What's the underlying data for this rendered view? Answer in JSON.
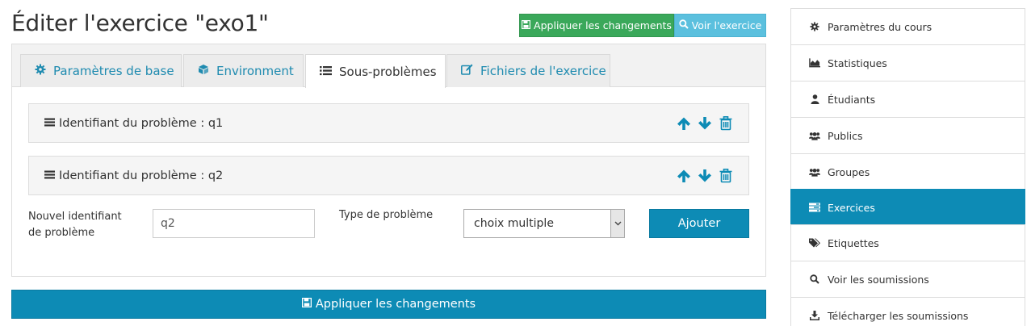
{
  "header": {
    "title": "Éditer l'exercice \"exo1\"",
    "apply_label": "Appliquer les changements",
    "view_label": "Voir l'exercice"
  },
  "tabs": [
    {
      "label": "Paramètres de base",
      "icon": "gear-icon"
    },
    {
      "label": "Environment",
      "icon": "cube-icon"
    },
    {
      "label": "Sous-problèmes",
      "icon": "list-icon",
      "active": true
    },
    {
      "label": "Fichiers de l'exercice",
      "icon": "edit-icon"
    }
  ],
  "problems": [
    {
      "label": "Identifiant du problème : q1"
    },
    {
      "label": "Identifiant du problème : q2"
    }
  ],
  "add_form": {
    "new_id_label_line1": "Nouvel identifiant",
    "new_id_label_line2": "de problème",
    "new_id_value": "q2",
    "type_label": "Type de problème",
    "type_value": "choix multiple",
    "add_label": "Ajouter"
  },
  "bottom": {
    "apply_label": "Appliquer les changements"
  },
  "sidebar": {
    "items": [
      {
        "label": "Paramètres du cours",
        "icon": "gear-icon"
      },
      {
        "label": "Statistiques",
        "icon": "area-chart-icon"
      },
      {
        "label": "Étudiants",
        "icon": "user-icon"
      },
      {
        "label": "Publics",
        "icon": "users-icon"
      },
      {
        "label": "Groupes",
        "icon": "users-icon"
      },
      {
        "label": "Exercices",
        "icon": "tasks-icon",
        "active": true
      },
      {
        "label": "Etiquettes",
        "icon": "tags-icon"
      },
      {
        "label": "Voir les soumissions",
        "icon": "search-icon"
      },
      {
        "label": "Télécharger les soumissions",
        "icon": "download-icon"
      }
    ]
  },
  "colors": {
    "primary": "#0d8bb5",
    "success": "#3aa85a",
    "info": "#5bc0de",
    "link": "#1f8bb0"
  }
}
